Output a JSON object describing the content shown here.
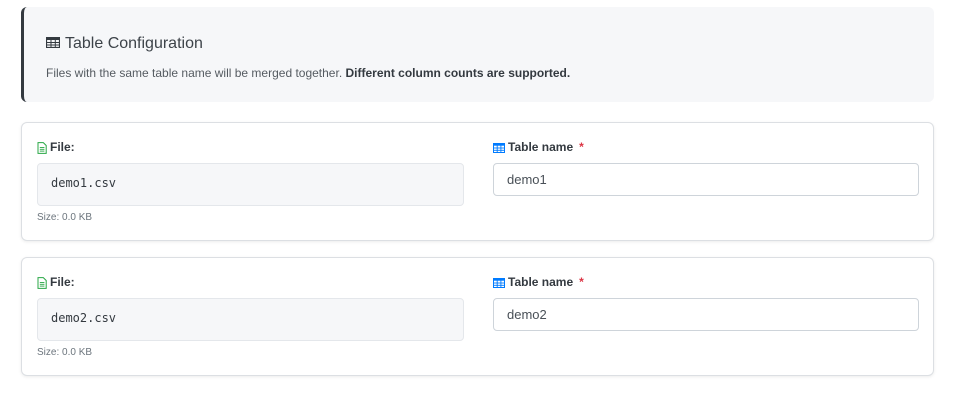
{
  "config": {
    "title": "Table Configuration",
    "description": "Files with the same table name will be merged together.",
    "description_bold": "Different column counts are supported."
  },
  "labels": {
    "file": "File:",
    "table_name": "Table name",
    "required_mark": "*"
  },
  "files": [
    {
      "filename": "demo1.csv",
      "size": "Size: 0.0 KB",
      "table_name": "demo1"
    },
    {
      "filename": "demo2.csv",
      "size": "Size: 0.0 KB",
      "table_name": "demo2"
    }
  ],
  "icons": {
    "header": "table-icon",
    "file": "file-text-icon",
    "table": "table-icon"
  },
  "colors": {
    "accent_border": "#343a40",
    "file_icon": "#28a745",
    "table_icon": "#007bff",
    "required": "#dc3545"
  }
}
